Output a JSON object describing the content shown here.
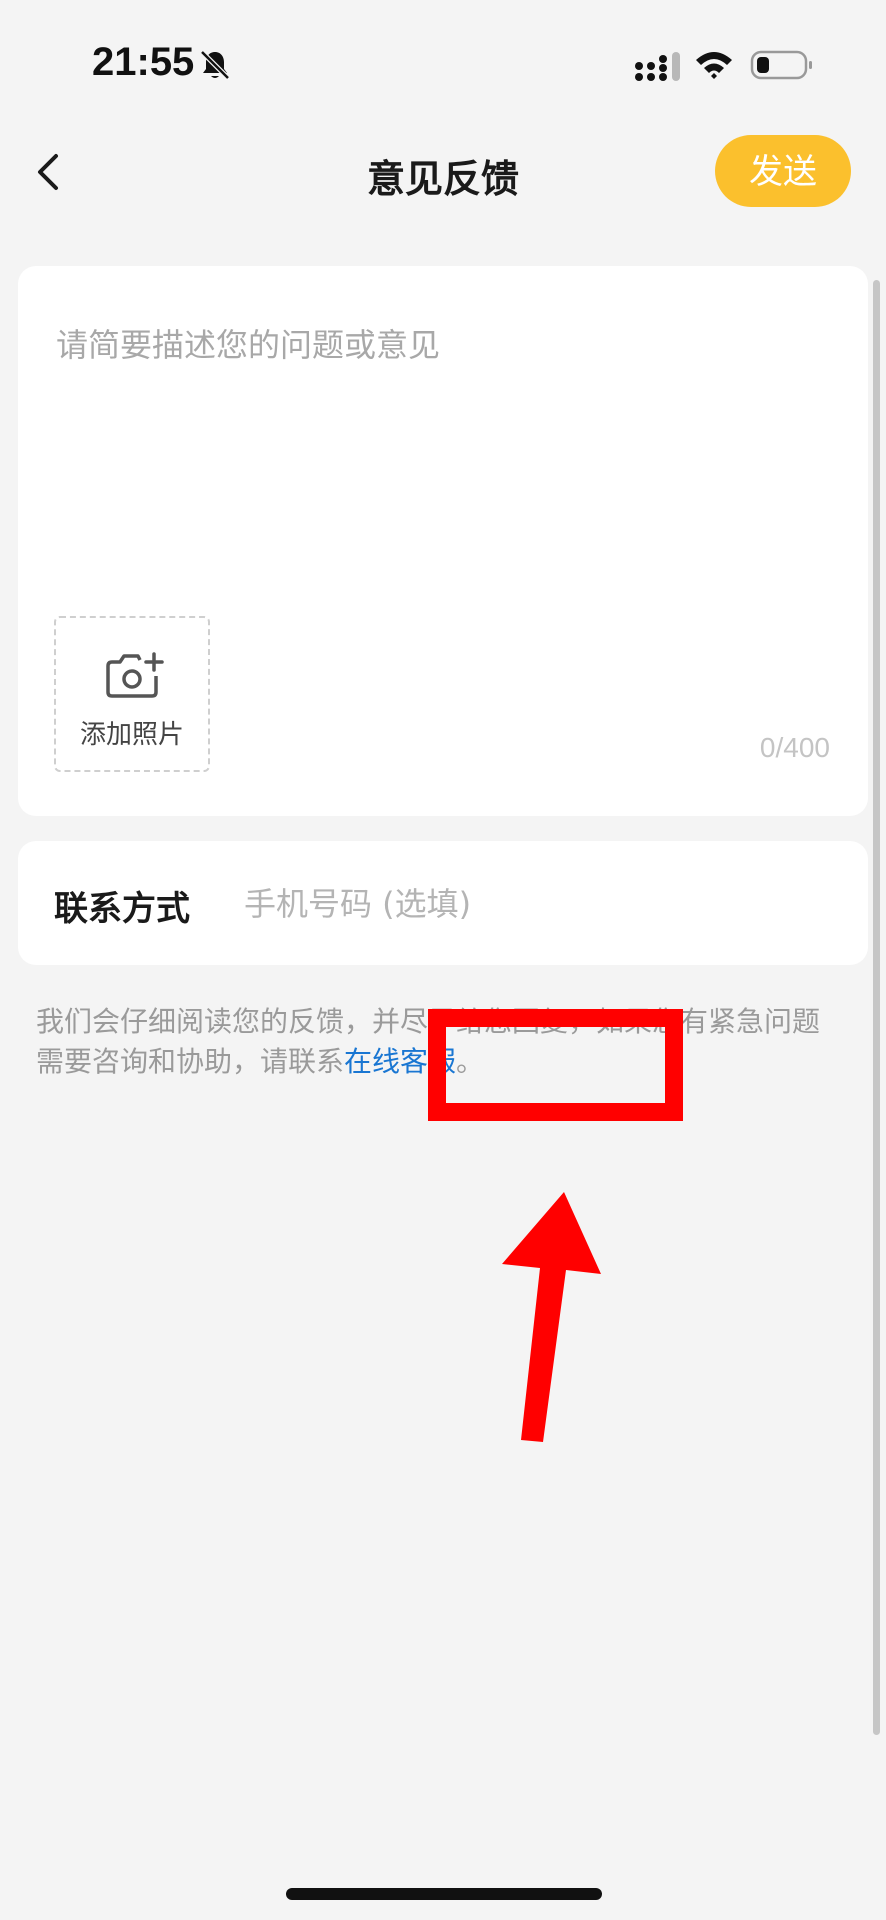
{
  "status_bar": {
    "time": "21:55",
    "icons": [
      "bell-off-icon",
      "signal-icon",
      "wifi-icon",
      "battery-icon"
    ]
  },
  "nav": {
    "back_icon": "chevron-left-icon",
    "title": "意见反馈",
    "send_label": "发送"
  },
  "feedback": {
    "placeholder": "请简要描述您的问题或意见",
    "add_photo_label": "添加照片",
    "counter": "0/400"
  },
  "contact": {
    "label": "联系方式",
    "placeholder": "手机号码 (选填)"
  },
  "notice": {
    "text": "我们会仔细阅读您的反馈，并尽早给您回复，如果您有紧急问题需要咨询和协助，请联系",
    "link": "在线客服",
    "suffix": "。"
  },
  "colors": {
    "accent": "#fbc02d",
    "link": "#1976d2",
    "annotation": "#ff0000",
    "background": "#f4f4f4"
  }
}
